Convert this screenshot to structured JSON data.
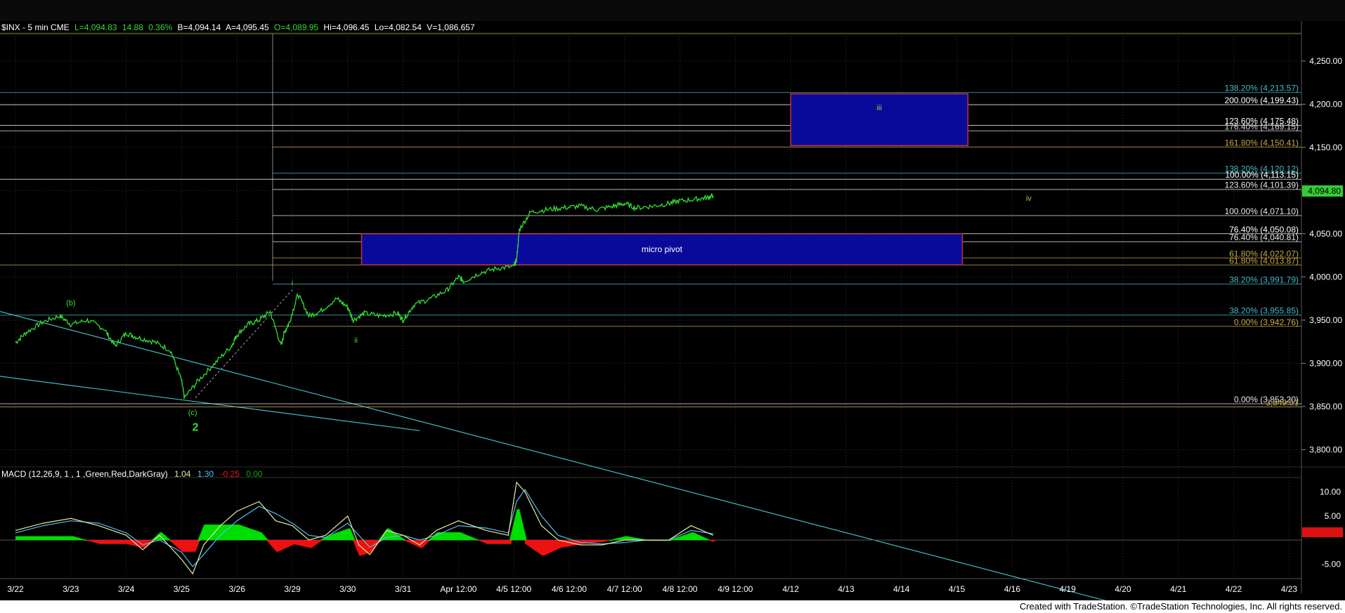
{
  "header": {
    "symbol": "$INX - 5 min  CME",
    "last": "L=4,094.83",
    "change": "14.88",
    "pct": "0.36%",
    "bid": "B=4,094.14",
    "ask": "A=4,095.45",
    "open": "O=4,089.95",
    "hi": "Hi=4,096.45",
    "lo": "Lo=4,082.54",
    "vol": "V=1,086,657"
  },
  "footer": {
    "text": "Created with TradeStation. ©TradeStation Technologies, Inc. All rights reserved."
  },
  "colors": {
    "price": "#33dd33",
    "macd_pos": "#00dd00",
    "macd_neg": "#ee1111",
    "macd_line": "#e8e8a0",
    "signal_line": "#55bbee",
    "trendline": "#44b8c0",
    "box_fill": "#0a0a9a",
    "box_border": "#c03040"
  },
  "chart_data": [
    {
      "type": "line",
      "name": "price-panel",
      "ylim": [
        3780,
        4280
      ],
      "y_ticks": [
        "4,250.00",
        "4,200.00",
        "4,150.00",
        "4,100.00",
        "4,050.00",
        "4,000.00",
        "3,950.00",
        "3,900.00",
        "3,850.00",
        "3,800.00"
      ],
      "y_tick_values": [
        4250,
        4200,
        4150,
        4100,
        4050,
        4000,
        3950,
        3900,
        3850,
        3800
      ],
      "x_ticks": [
        "3/22",
        "3/23",
        "3/24",
        "3/25",
        "3/26",
        "3/29",
        "3/30",
        "3/31",
        "Apr 12:00",
        "4/5 12:00",
        "4/6 12:00",
        "4/7 12:00",
        "4/8 12:00",
        "4/9 12:00",
        "4/12",
        "4/13",
        "4/14",
        "4/15",
        "4/16",
        "4/19",
        "4/20",
        "4/21",
        "4/22",
        "4/23"
      ],
      "last_price_label": "4,094.80",
      "series": [
        {
          "x": [
            0,
            0.2,
            0.5,
            0.8,
            1.0,
            1.3,
            1.6,
            1.8,
            2.0,
            2.2,
            2.5,
            2.8,
            3.0,
            3.05,
            3.3,
            3.6,
            3.9,
            4.0,
            4.2,
            4.4,
            4.6,
            4.8,
            4.85,
            4.95,
            5.1,
            5.3,
            5.5,
            5.8,
            6.0,
            6.1,
            6.3,
            6.6,
            6.9,
            7.0,
            7.2,
            7.5,
            7.8,
            8.0,
            8.1,
            8.4,
            8.7,
            9.0,
            9.05,
            9.1,
            9.3,
            9.6,
            9.9,
            10.2,
            10.5,
            10.8,
            11.0,
            11.2,
            11.5,
            11.8,
            12.0,
            12.3,
            12.5,
            12.6
          ],
          "y": [
            3924,
            3936,
            3948,
            3955,
            3945,
            3950,
            3940,
            3920,
            3935,
            3930,
            3925,
            3915,
            3880,
            3860,
            3880,
            3900,
            3920,
            3933,
            3945,
            3950,
            3960,
            3920,
            3935,
            3948,
            3980,
            3955,
            3960,
            3975,
            3965,
            3950,
            3958,
            3955,
            3958,
            3950,
            3968,
            3975,
            3985,
            4000,
            3995,
            4005,
            4010,
            4012,
            4020,
            4055,
            4075,
            4078,
            4080,
            4082,
            4078,
            4082,
            4085,
            4080,
            4082,
            4085,
            4088,
            4090,
            4092,
            4094
          ]
        }
      ],
      "fib_levels": [
        {
          "label": "138.20% (4,213.57)",
          "value": 4213.57,
          "color": "#44b8c8"
        },
        {
          "label": "200.00% (4,199.43)",
          "value": 4199.43,
          "color": "#ffffff"
        },
        {
          "label": "123.60% (4,175.48)",
          "value": 4175.48,
          "color": "#ffffff"
        },
        {
          "label": "176.40% (4,169.15)",
          "value": 4169.15,
          "color": "#d8d8d8"
        },
        {
          "label": "161.80% (4,150.41)",
          "value": 4150.41,
          "color": "#c8a848"
        },
        {
          "label": "138.20% (4,120.12)",
          "value": 4120.12,
          "color": "#44b8c8"
        },
        {
          "label": "100.00% (4,113.15)",
          "value": 4113.15,
          "color": "#ffffff"
        },
        {
          "label": "123.60% (4,101.39)",
          "value": 4101.39,
          "color": "#e8e8e8"
        },
        {
          "label": "100.00% (4,071.10)",
          "value": 4071.1,
          "color": "#e8e8e8"
        },
        {
          "label": "76.40% (4,050.08)",
          "value": 4050.08,
          "color": "#ffffff"
        },
        {
          "label": "76.40% (4,040.81)",
          "value": 4040.81,
          "color": "#e8e8e8"
        },
        {
          "label": "61.80% (4,022.07)",
          "value": 4022.07,
          "color": "#c8a848"
        },
        {
          "label": "61.80% (4,013.87)",
          "value": 4013.87,
          "color": "#c8a848"
        },
        {
          "label": "38.20% (3,991.79)",
          "value": 3991.79,
          "color": "#44b8c8"
        },
        {
          "label": "38.20% (3,955.85)",
          "value": 3955.85,
          "color": "#44b8c8"
        },
        {
          "label": "0.00% (3,942.76)",
          "value": 3942.76,
          "color": "#c8a848"
        },
        {
          "label": "0.00% (3,853.20)",
          "value": 3853.2,
          "color": "#e8e8e8"
        },
        {
          "label": "3,849.51",
          "value": 3849.51,
          "color": "#c8a848"
        }
      ],
      "zones": [
        {
          "label": "iii",
          "x": [
            14.0,
            17.2
          ],
          "y": [
            4152,
            4212
          ]
        },
        {
          "label": "micro pivot",
          "x": [
            6.25,
            17.1
          ],
          "y": [
            4014,
            4050
          ]
        }
      ],
      "wave_labels": [
        {
          "label": "(b)",
          "x": 1.0,
          "y": 3967
        },
        {
          "label": "(c)",
          "x": 3.2,
          "y": 3840
        },
        {
          "label": "2",
          "x": 3.25,
          "y": 3822
        },
        {
          "label": "i",
          "x": 5.0,
          "y": 3990
        },
        {
          "label": "ii",
          "x": 6.15,
          "y": 3924
        },
        {
          "label": "iii",
          "x": 15.6,
          "y": 4193
        },
        {
          "label": "iv",
          "x": 18.3,
          "y": 4088
        }
      ]
    },
    {
      "type": "line",
      "name": "MACD panel",
      "title": "MACD (12,26,9, 1  , 1  ,Green,Red,DarkGray)",
      "legend_values": [
        "1.04",
        "1.30",
        "-0.25",
        "0.00"
      ],
      "ylim": [
        -8,
        13
      ],
      "y_ticks": [
        "10.00",
        "5.00",
        "-0.25",
        "-5.00"
      ],
      "y_tick_values": [
        10,
        5,
        -0.25,
        -5
      ],
      "series": [
        {
          "name": "MACD",
          "x": [
            0,
            0.5,
            1.0,
            1.5,
            2.0,
            2.3,
            2.6,
            3.0,
            3.2,
            3.4,
            3.7,
            4.0,
            4.4,
            4.7,
            5.0,
            5.3,
            5.6,
            6.0,
            6.2,
            6.4,
            6.7,
            7.0,
            7.3,
            7.6,
            8.0,
            8.5,
            8.9,
            9.05,
            9.2,
            9.5,
            9.8,
            10.2,
            10.6,
            11.0,
            11.4,
            11.8,
            12.2,
            12.6
          ],
          "y": [
            2,
            3.5,
            4.5,
            3,
            1,
            -2,
            1,
            -4,
            -7,
            -1,
            3,
            6,
            8,
            4,
            3,
            0,
            1,
            5,
            -1,
            -3,
            2,
            1,
            -1,
            2,
            4,
            2,
            1,
            12,
            10,
            3,
            0,
            -1,
            -1,
            0,
            0,
            0,
            3,
            1
          ]
        },
        {
          "name": "Signal",
          "x": [
            0,
            0.5,
            1.0,
            1.5,
            2.0,
            2.3,
            2.6,
            3.0,
            3.2,
            3.4,
            3.7,
            4.0,
            4.4,
            4.7,
            5.0,
            5.3,
            5.6,
            6.0,
            6.2,
            6.4,
            6.7,
            7.0,
            7.3,
            7.6,
            8.0,
            8.5,
            8.9,
            9.05,
            9.2,
            9.5,
            9.8,
            10.2,
            10.6,
            11.0,
            11.4,
            11.8,
            12.2,
            12.6
          ],
          "y": [
            1.5,
            3,
            4,
            3.5,
            1.5,
            -1,
            0,
            -2.5,
            -5.5,
            -3,
            1,
            4,
            7,
            5.5,
            3.5,
            1,
            0.5,
            3.5,
            1,
            -1.5,
            0.5,
            1,
            0,
            1,
            3,
            2.5,
            1.5,
            8,
            10.5,
            5,
            1,
            -0.5,
            -0.8,
            -0.5,
            0,
            0,
            2,
            1.3
          ]
        }
      ]
    }
  ]
}
